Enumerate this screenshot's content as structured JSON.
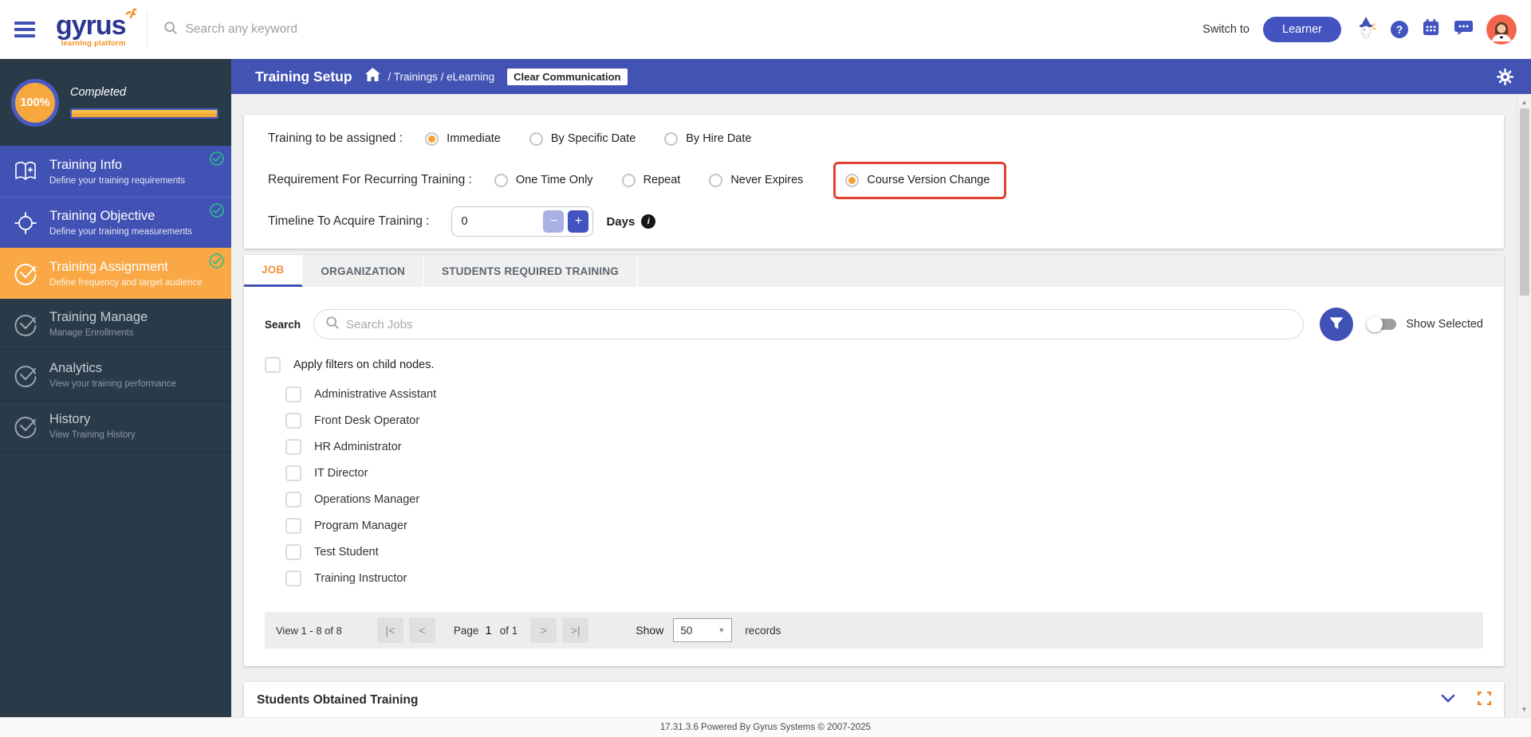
{
  "colors": {
    "accent_blue": "#4353b4",
    "sidebar_dark": "#293a49",
    "orange": "#f9a845",
    "green_check": "#2fbd8a",
    "highlight_red": "#e2402f",
    "filter_blue": "#3f51b5"
  },
  "header": {
    "logo_text": "gyrus",
    "logo_sub": "learning platform",
    "search_placeholder": "Search any keyword",
    "switch_to": "Switch to",
    "learner_button": "Learner",
    "help_glyph": "?"
  },
  "breadcrumb": {
    "title": "Training Setup",
    "path": "/ Trainings / eLearning",
    "chip": "Clear Communication"
  },
  "sidebar": {
    "progress_percent": "100%",
    "progress_label": "Completed",
    "items": [
      {
        "label": "Training Info",
        "sub": "Define your training requirements"
      },
      {
        "label": "Training Objective",
        "sub": "Define your training measurements"
      },
      {
        "label": "Training Assignment",
        "sub": "Define frequency and target audience"
      },
      {
        "label": "Training Manage",
        "sub": "Manage Enrollments"
      },
      {
        "label": "Analytics",
        "sub": "View your training performance"
      },
      {
        "label": "History",
        "sub": "View Training History"
      }
    ]
  },
  "assignment": {
    "assigned_label": "Training to be assigned :",
    "assigned_options": [
      {
        "label": "Immediate",
        "selected": true
      },
      {
        "label": "By Specific Date",
        "selected": false
      },
      {
        "label": "By Hire Date",
        "selected": false
      }
    ],
    "recurring_label": "Requirement For Recurring Training :",
    "recurring_options": [
      {
        "label": "One Time Only",
        "selected": false
      },
      {
        "label": "Repeat",
        "selected": false
      },
      {
        "label": "Never Expires",
        "selected": false
      },
      {
        "label": "Course Version Change",
        "selected": true,
        "highlighted": true
      }
    ],
    "timeline_label": "Timeline To Acquire Training :",
    "timeline_value": "0",
    "minus_glyph": "−",
    "plus_glyph": "+",
    "timeline_unit": "Days",
    "info_glyph": "i"
  },
  "tabs": [
    {
      "label": "JOB",
      "active": true
    },
    {
      "label": "ORGANIZATION",
      "active": false
    },
    {
      "label": "STUDENTS REQUIRED TRAINING",
      "active": false
    }
  ],
  "job_panel": {
    "search_label": "Search",
    "search_placeholder": "Search Jobs",
    "show_selected": "Show Selected",
    "apply_filters": "Apply filters on child nodes.",
    "jobs": [
      "Administrative Assistant",
      "Front Desk Operator",
      "HR Administrator",
      "IT Director",
      "Operations Manager",
      "Program Manager",
      "Test Student",
      "Training Instructor"
    ],
    "pagination": {
      "view_text": "View 1 - 8 of 8",
      "first_glyph": "|<",
      "prev_glyph": "<",
      "page_label": "Page",
      "page_value": "1",
      "of_label": "of 1",
      "next_glyph": ">",
      "last_glyph": ">|",
      "show_label": "Show",
      "page_size": "50",
      "dropdown_glyph": "▼",
      "records_label": "records"
    }
  },
  "students_obtained": {
    "title": "Students Obtained Training"
  },
  "footer": {
    "text": "17.31.3.6 Powered By Gyrus Systems © 2007-2025"
  },
  "scrollbar": {
    "up_glyph": "▲",
    "down_glyph": "▼"
  }
}
